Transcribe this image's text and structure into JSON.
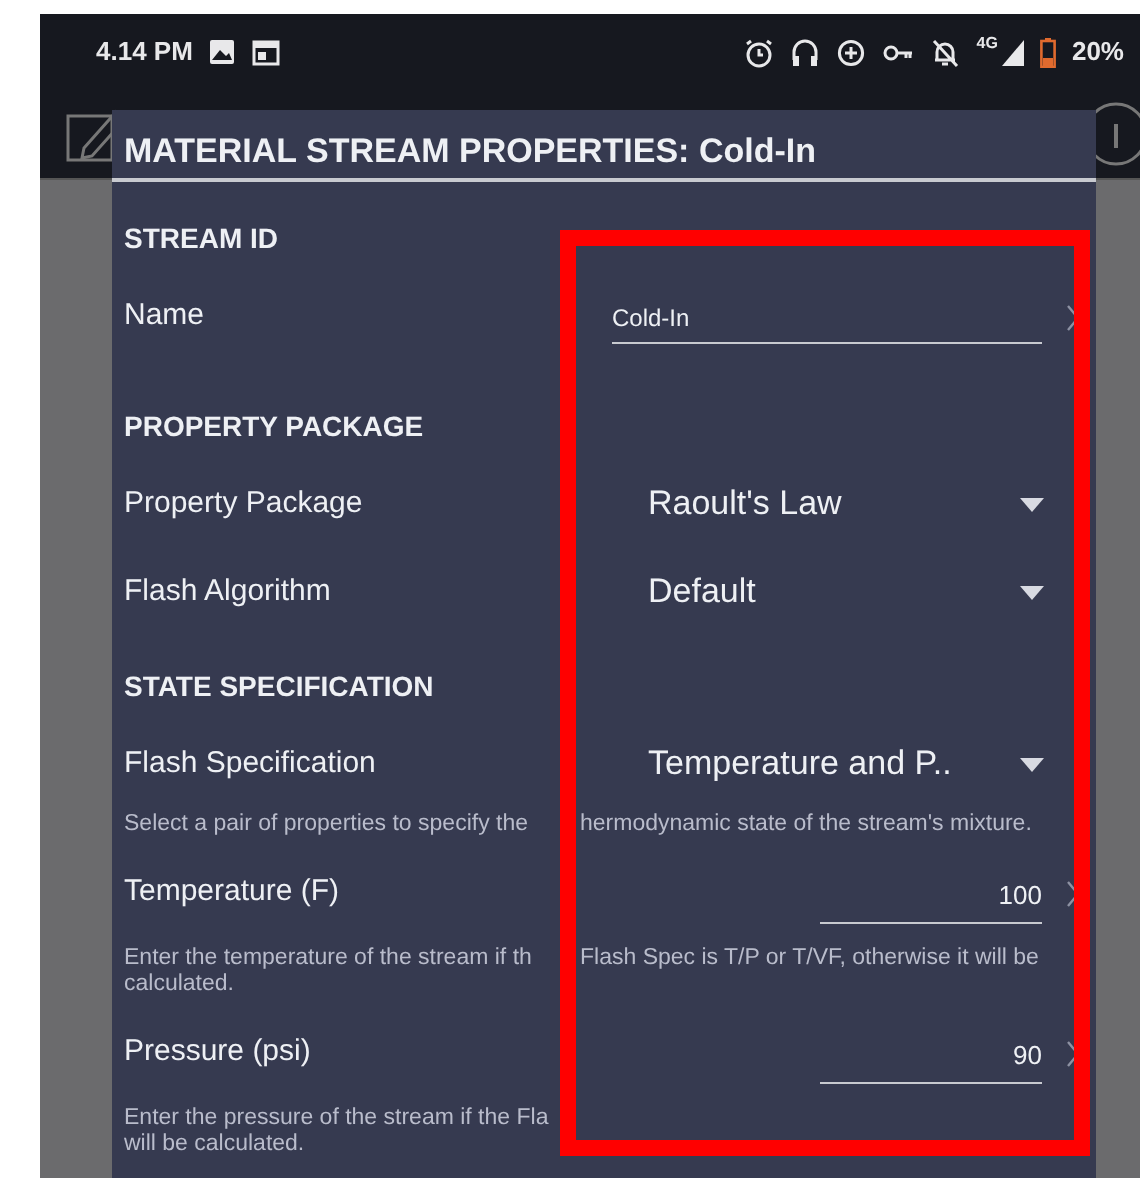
{
  "status_bar": {
    "time": "4.14 PM",
    "network": "4G",
    "battery": "20%"
  },
  "dialog": {
    "title": "MATERIAL STREAM PROPERTIES: Cold-In",
    "sections": [
      {
        "heading": "STREAM ID",
        "rows": [
          {
            "kind": "text",
            "label": "Name",
            "value": "Cold-In"
          }
        ]
      },
      {
        "heading": "PROPERTY PACKAGE",
        "rows": [
          {
            "kind": "dropdown",
            "label": "Property Package",
            "value": "Raoult's Law"
          },
          {
            "kind": "dropdown",
            "label": "Flash Algorithm",
            "value": "Default"
          }
        ]
      },
      {
        "heading": "STATE SPECIFICATION",
        "rows": [
          {
            "kind": "dropdown",
            "label": "Flash Specification",
            "value": "Temperature and P..",
            "hint_lines": [
              [
                "Select a pair of properties to specify the",
                "hermodynamic state of the stream's mixture."
              ]
            ]
          },
          {
            "kind": "number",
            "label": "Temperature (F)",
            "value": "100",
            "hint_lines": [
              [
                "Enter the temperature of the stream if th",
                "Flash Spec is T/P or T/VF, otherwise it will be"
              ],
              [
                "calculated."
              ]
            ]
          },
          {
            "kind": "number",
            "label": "Pressure (psi)",
            "value": "90",
            "hint_lines": [
              [
                "Enter the pressure of the stream if the Fla"
              ],
              [
                "will be calculated."
              ]
            ]
          }
        ]
      }
    ]
  },
  "highlight": {
    "shown": true
  }
}
